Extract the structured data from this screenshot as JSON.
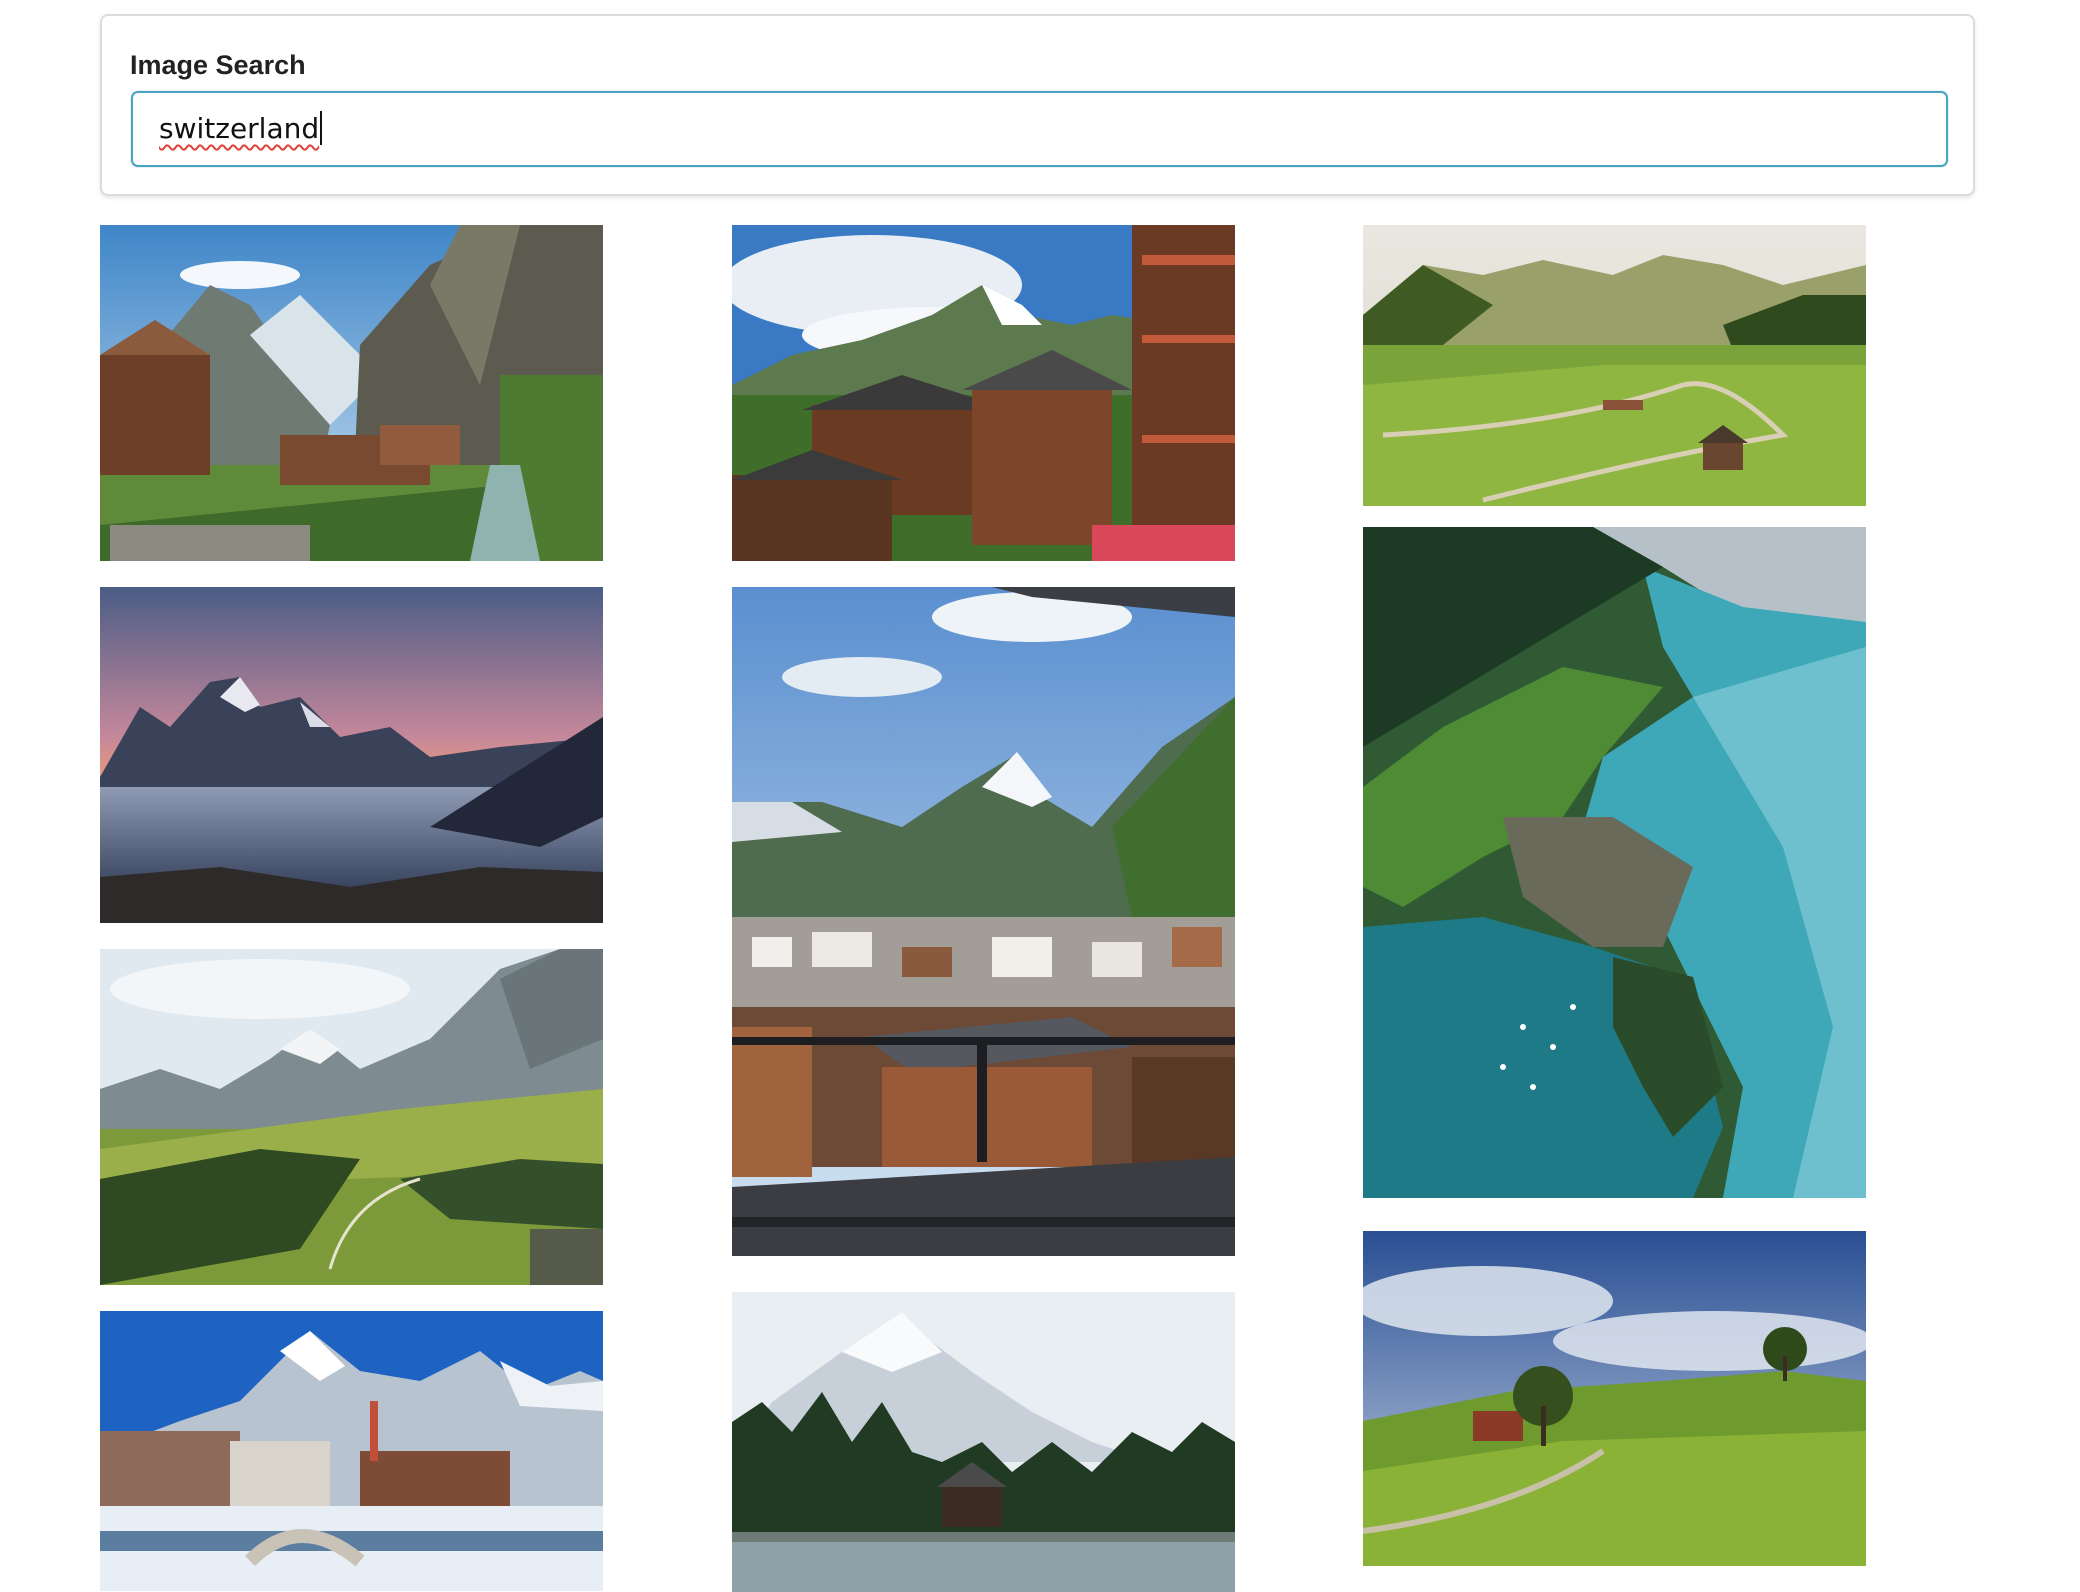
{
  "search": {
    "label": "Image Search",
    "value": "switzerland"
  },
  "results": [
    {
      "id": "result-1",
      "scene": "lauterbrunnen-valley-village-cliffs"
    },
    {
      "id": "result-2",
      "scene": "alpine-chalets-cloudy-peaks"
    },
    {
      "id": "result-3",
      "scene": "green-valley-winding-road"
    },
    {
      "id": "result-4",
      "scene": "sunset-peaks-sea-of-clouds"
    },
    {
      "id": "result-5",
      "scene": "matterhorn-over-village-balcony-view"
    },
    {
      "id": "result-6",
      "scene": "aerial-lake-peninsula-village"
    },
    {
      "id": "result-7",
      "scene": "alpine-meadow-valley-peaks"
    },
    {
      "id": "result-8",
      "scene": "snowy-peak-forest-lake-cabin"
    },
    {
      "id": "result-9",
      "scene": "green-hill-tree-barn-path"
    },
    {
      "id": "result-10",
      "scene": "winter-village-snowy-mountain"
    }
  ]
}
